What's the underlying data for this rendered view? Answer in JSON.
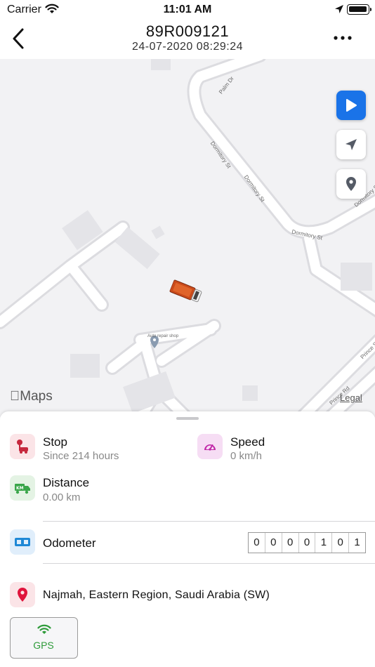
{
  "status_bar": {
    "carrier": "Carrier",
    "time": "11:01 AM"
  },
  "nav": {
    "title": "89R009121",
    "subtitle": "24-07-2020 08:29:24"
  },
  "map": {
    "attribution": "Maps",
    "legal": "Legal",
    "street_labels": [
      "Palm Dr",
      "Dormitory St",
      "Dormitory St",
      "Dormitory St",
      "Dormitory St",
      "Prince St",
      "Prince Rd"
    ],
    "place_label": "Auto repair shop"
  },
  "details": {
    "status": {
      "label": "Stop",
      "value": "Since 214 hours"
    },
    "speed": {
      "label": "Speed",
      "value": "0 km/h"
    },
    "distance": {
      "label": "Distance",
      "value": "0.00 km"
    },
    "odometer": {
      "label": "Odometer",
      "digits": [
        "0",
        "0",
        "0",
        "0",
        "1",
        "0",
        "1"
      ]
    },
    "address": "Najmah, Eastern Region, Saudi Arabia (SW)",
    "gps_button": "GPS"
  },
  "colors": {
    "accent_blue": "#1a73e8",
    "stop_red": "#c6283e",
    "speed_magenta": "#c026a7",
    "distance_green": "#3aa64a",
    "odometer_blue": "#1e88d6",
    "gps_green": "#2e9b3a"
  },
  "icons": {
    "back": "chevron-left-icon",
    "more": "ellipsis-icon",
    "play": "play-icon",
    "locate": "location-arrow-icon",
    "pin": "map-pin-icon",
    "stop": "parking-stop-icon",
    "speed": "speedometer-icon",
    "distance": "truck-km-icon",
    "odometer": "odometer-icon",
    "address": "location-pin-icon",
    "gps": "wifi-signal-icon"
  }
}
